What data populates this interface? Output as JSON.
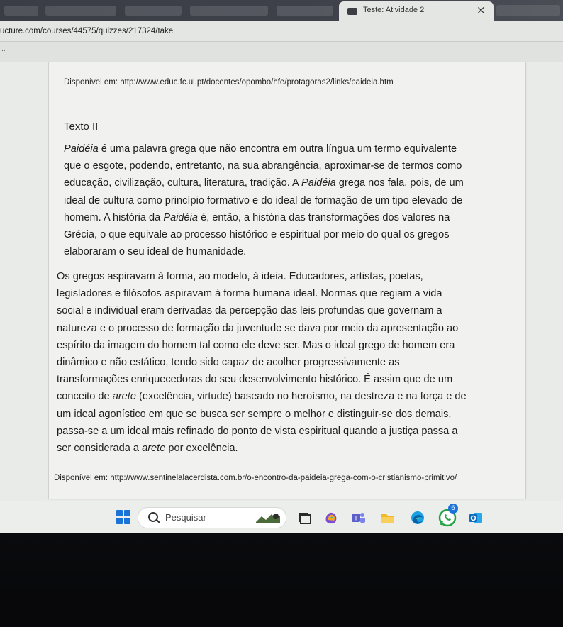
{
  "browser": {
    "tab_title": "Teste: Atividade 2",
    "tab_close": "×",
    "url": "ucture.com/courses/44575/quizzes/217324/take",
    "bookmarks_overflow": "..",
    "tab_icon": "monitor-icon",
    "close_icon": "close-icon"
  },
  "content": {
    "source_1": "Disponível em: http://www.educ.fc.ul.pt/docentes/opombo/hfe/protagoras2/links/paideia.htm",
    "heading": "Texto II",
    "para1": {
      "term": "Paidéia",
      "s1": " é uma palavra grega que não encontra em outra língua um termo equivalente",
      "s2": "que o esgote, podendo, entretanto, na sua abrangência, aproximar-se de termos como",
      "s3a": "educação, civilização, cultura, literatura, tradição. A ",
      "s3b": " grega nos fala, pois, de um",
      "s4": "ideal de cultura como princípio formativo e do ideal de formação de um tipo elevado de",
      "s5a": "homem. A história da ",
      "s5b": " é, então, a história das transformações dos valores na",
      "s6": "Grécia, o que equivale ao processo histórico e espiritual por meio do qual os gregos",
      "s7": "elaboraram o seu ideal de humanidade."
    },
    "para2": {
      "term": "arete",
      "l1": "Os gregos aspiravam à forma, ao modelo, à ideia. Educadores, artistas, poetas,",
      "l2": "legisladores e filósofos aspiravam à forma humana ideal. Normas que regiam a vida",
      "l3": "social e individual eram derivadas da percepção das leis profundas que governam a",
      "l4": "natureza e o processo de formação da juventude se dava por meio da apresentação ao",
      "l5": "espírito da imagem do homem tal como ele deve ser. Mas o ideal grego de homem era",
      "l6": "dinâmico e não estático, tendo sido capaz de acolher progressivamente as",
      "l7": "transformações enriquecedoras do seu desenvolvimento histórico. É assim que de um",
      "l8a": "conceito de ",
      "l8b": " (excelência, virtude) baseado no heroísmo, na destreza e na força e de",
      "l9": "um ideal agonístico em que se busca ser sempre o melhor e distinguir-se dos demais,",
      "l10": "passa-se a um ideal mais refinado do ponto de vista espiritual quando a justiça passa a",
      "l11a": "ser considerada a ",
      "l11b": " por excelência."
    },
    "source_2": "Disponível em: http://www.sentinelalacerdista.com.br/o-encontro-da-paideia-grega-com-o-cristianismo-primitivo/"
  },
  "taskbar": {
    "search_label": "Pesquisar",
    "notification_count": "6",
    "icons": [
      "windows-start-icon",
      "search-icon",
      "task-view-icon",
      "copilot-icon",
      "teams-icon",
      "file-explorer-icon",
      "edge-icon",
      "whatsapp-icon",
      "outlook-icon"
    ],
    "colors": {
      "accent": "#1a73d6",
      "whatsapp": "#25a244",
      "teams": "#5b5fc7",
      "explorer": "#f2b82a",
      "outlook": "#0f6cbd"
    }
  }
}
